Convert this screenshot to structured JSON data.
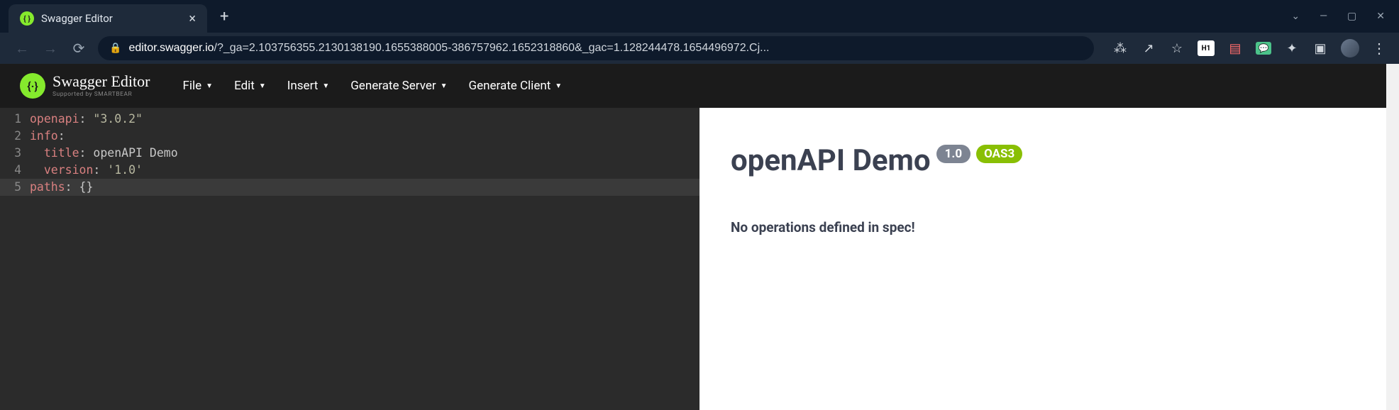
{
  "browser": {
    "tab_title": "Swagger Editor",
    "url_domain": "editor.swagger.io",
    "url_path": "/?_ga=2.103756355.2130138190.1655388005-386757962.1652318860&_gac=1.128244478.1654496972.Cj..."
  },
  "app": {
    "logo_title": "Swagger Editor",
    "logo_sub": "Supported by SMARTBEAR",
    "menu": {
      "file": "File",
      "edit": "Edit",
      "insert": "Insert",
      "gen_server": "Generate Server",
      "gen_client": "Generate Client"
    }
  },
  "editor": {
    "lines": [
      {
        "no": "1",
        "tokens": [
          {
            "c": "k-key",
            "t": "openapi"
          },
          {
            "c": "k-punc",
            "t": ": "
          },
          {
            "c": "k-str",
            "t": "\"3.0.2\""
          }
        ]
      },
      {
        "no": "2",
        "tokens": [
          {
            "c": "k-key",
            "t": "info"
          },
          {
            "c": "k-punc",
            "t": ":"
          }
        ]
      },
      {
        "no": "3",
        "tokens": [
          {
            "c": "k-txt",
            "t": "  "
          },
          {
            "c": "k-key",
            "t": "title"
          },
          {
            "c": "k-punc",
            "t": ": "
          },
          {
            "c": "k-txt",
            "t": "openAPI Demo"
          }
        ]
      },
      {
        "no": "4",
        "tokens": [
          {
            "c": "k-txt",
            "t": "  "
          },
          {
            "c": "k-key",
            "t": "version"
          },
          {
            "c": "k-punc",
            "t": ": "
          },
          {
            "c": "k-str",
            "t": "'1.0'"
          }
        ]
      },
      {
        "no": "5",
        "hl": true,
        "tokens": [
          {
            "c": "k-key",
            "t": "paths"
          },
          {
            "c": "k-punc",
            "t": ": "
          },
          {
            "c": "k-txt",
            "t": "{}"
          }
        ]
      }
    ]
  },
  "preview": {
    "title": "openAPI Demo",
    "version_badge": "1.0",
    "oas_badge": "OAS3",
    "no_ops": "No operations defined in spec!"
  }
}
